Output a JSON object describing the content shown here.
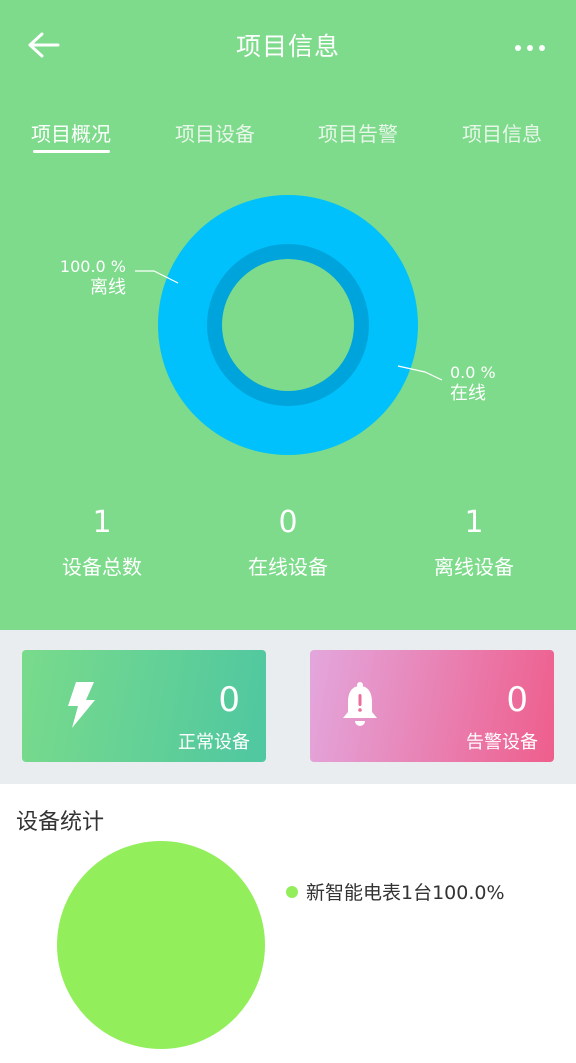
{
  "header": {
    "title": "项目信息",
    "back_icon": "arrow-left-icon",
    "more_icon": "more-dots-icon"
  },
  "tabs": [
    {
      "label": "项目概况",
      "active": true
    },
    {
      "label": "项目设备",
      "active": false
    },
    {
      "label": "项目告警",
      "active": false
    },
    {
      "label": "项目信息",
      "active": false
    }
  ],
  "donut": {
    "offline": {
      "percent": "100.0 %",
      "label": "离线",
      "fraction": 1.0
    },
    "online": {
      "percent": "0.0 %",
      "label": "在线",
      "fraction": 0.0
    },
    "colors": {
      "outer": "#00c1fb",
      "inner": "#00a4dc"
    }
  },
  "stats": [
    {
      "value": "1",
      "label": "设备总数"
    },
    {
      "value": "0",
      "label": "在线设备"
    },
    {
      "value": "1",
      "label": "离线设备"
    }
  ],
  "cards": {
    "normal": {
      "value": "0",
      "label": "正常设备",
      "icon": "lightning-icon"
    },
    "alarm": {
      "value": "0",
      "label": "告警设备",
      "icon": "bell-icon"
    }
  },
  "device_stats": {
    "title": "设备统计",
    "legend": [
      {
        "text": "新智能电表1台100.0%",
        "color": "#93ee5c"
      }
    ]
  },
  "colors": {
    "top_bg": "#7ddb8b",
    "pie": "#93ee5c"
  }
}
